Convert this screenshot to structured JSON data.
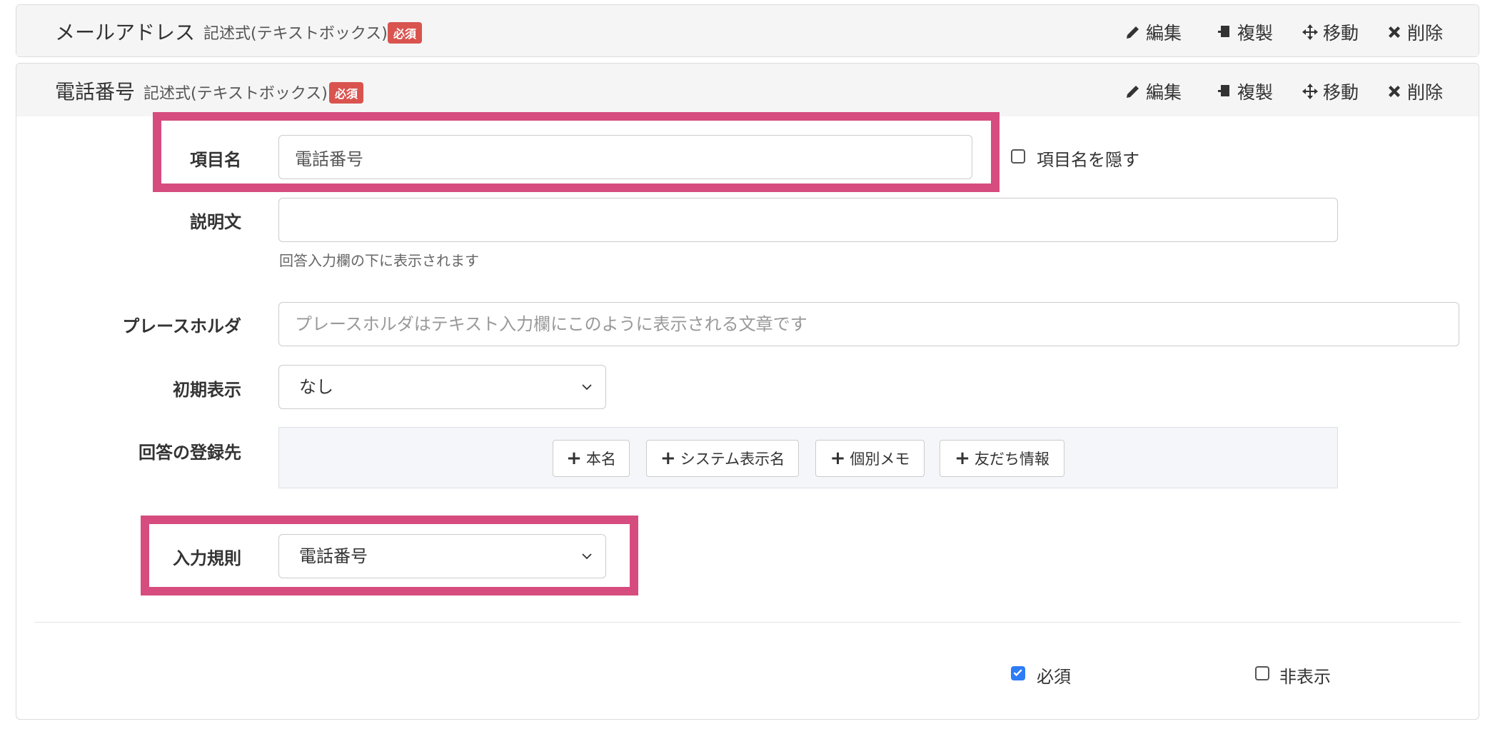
{
  "fields": [
    {
      "title": "メールアドレス",
      "type_label": "記述式(テキストボックス)",
      "required_badge": "必須",
      "actions": {
        "edit": "編集",
        "copy": "複製",
        "move": "移動",
        "delete": "削除"
      }
    },
    {
      "title": "電話番号",
      "type_label": "記述式(テキストボックス)",
      "required_badge": "必須",
      "actions": {
        "edit": "編集",
        "copy": "複製",
        "move": "移動",
        "delete": "削除"
      }
    }
  ],
  "editor": {
    "item_name_label": "項目名",
    "item_name_value": "電話番号",
    "hide_name_label": "項目名を隠す",
    "hide_name_checked": false,
    "description_label": "説明文",
    "description_value": "",
    "description_help": "回答入力欄の下に表示されます",
    "placeholder_label": "プレースホルダ",
    "placeholder_placeholder": "プレースホルダはテキスト入力欄にこのように表示される文章です",
    "initial_label": "初期表示",
    "initial_value": "なし",
    "destination_label": "回答の登録先",
    "destination_buttons": [
      "本名",
      "システム表示名",
      "個別メモ",
      "友だち情報"
    ],
    "rule_label": "入力規則",
    "rule_value": "電話番号",
    "required_label": "必須",
    "required_checked": true,
    "hidden_label": "非表示",
    "hidden_checked": false
  },
  "colors": {
    "highlight": "#d64c7f",
    "badge": "#d9534f",
    "checkbox_on": "#2e7cf6"
  }
}
